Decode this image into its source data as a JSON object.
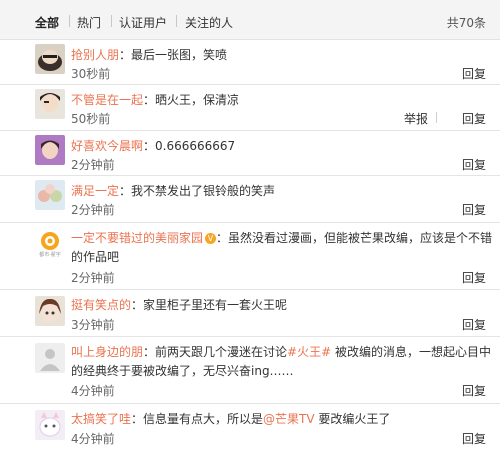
{
  "tabs": [
    {
      "label": "全部"
    },
    {
      "label": "热门"
    },
    {
      "label": "认证用户"
    },
    {
      "label": "关注的人"
    }
  ],
  "total_label": "共70条",
  "actions": {
    "reply": "回复",
    "report": "举报"
  },
  "comments": [
    {
      "user": "抢别人朋",
      "text": "：最后一张图，笑喷",
      "time": "30秒前"
    },
    {
      "user": "不管是在一起",
      "text": "：晒火王，保清凉",
      "time": "50秒前"
    },
    {
      "user": "好喜欢今晨啊",
      "text": "：0.666666667",
      "time": "2分钟前"
    },
    {
      "user": "满足一定",
      "text": "：我不禁发出了银铃般的笑声",
      "time": "2分钟前"
    },
    {
      "user": "一定不要错过的美丽家园",
      "text": "：虽然没看过漫画，但能被芒果改编，应该是个不错",
      "text2": "的作品吧",
      "time": "2分钟前",
      "avatar_text": "都市·翟宇"
    },
    {
      "user": "挺有笑点的",
      "text": "：家里柜子里还有一套火王呢",
      "time": "3分钟前"
    },
    {
      "user": "叫上身边的朋",
      "text_a": "：前两天跟几个漫迷在讨论",
      "topic": "#火王#",
      "text_b": " 被改编的消息，一想起心目中",
      "text2": "的经典终于要被改编了，无尽兴奋ing……",
      "time": "4分钟前"
    },
    {
      "user": "太搞笑了哇",
      "text_a": "：信息量有点大，所以是",
      "mention": "@芒果TV",
      "text_b": " 要改编火王了",
      "time": "4分钟前"
    }
  ]
}
